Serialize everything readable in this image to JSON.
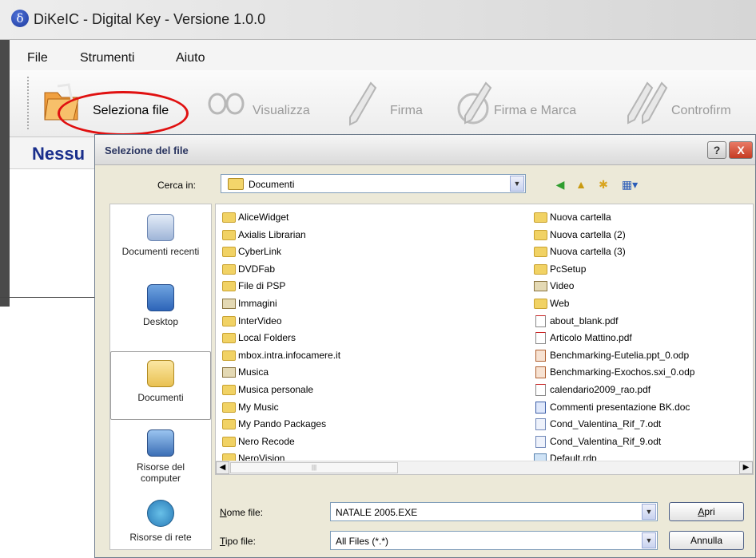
{
  "app": {
    "title": "DiKeIC - Digital Key - Versione 1.0.0",
    "icon_glyph": "δ",
    "menu": [
      "File",
      "Strumenti",
      "Aiuto"
    ],
    "toolbar": [
      {
        "label": "Seleziona file",
        "icon": "folder-icon",
        "enabled": true
      },
      {
        "label": "Visualizza",
        "icon": "glasses-icon",
        "enabled": false
      },
      {
        "label": "Firma",
        "icon": "pen-icon",
        "enabled": false
      },
      {
        "label": "Firma e Marca",
        "icon": "pen-stamp-icon",
        "enabled": false
      },
      {
        "label": "Controfirm",
        "icon": "double-pen-icon",
        "enabled": false
      }
    ],
    "status_text": "Nessu"
  },
  "dialog": {
    "title": "Selezione del file",
    "help_label": "?",
    "close_label": "X",
    "lookin_label": "Cerca in:",
    "lookin_value": "Documenti",
    "places": [
      {
        "label": "Documenti recenti",
        "icon": "recent-documents-icon"
      },
      {
        "label": "Desktop",
        "icon": "desktop-icon"
      },
      {
        "label": "Documenti",
        "icon": "documents-folder-icon",
        "selected": true
      },
      {
        "label": "Risorse del computer",
        "icon": "computer-icon"
      },
      {
        "label": "Risorse di rete",
        "icon": "network-icon"
      }
    ],
    "files_col1": [
      {
        "name": "AliceWidget",
        "type": "folder"
      },
      {
        "name": "Axialis Librarian",
        "type": "folder"
      },
      {
        "name": "CyberLink",
        "type": "folder"
      },
      {
        "name": "DVDFab",
        "type": "folder"
      },
      {
        "name": "File di PSP",
        "type": "folder"
      },
      {
        "name": "Immagini",
        "type": "special"
      },
      {
        "name": "InterVideo",
        "type": "folder"
      },
      {
        "name": "Local Folders",
        "type": "folder"
      },
      {
        "name": "mbox.intra.infocamere.it",
        "type": "folder"
      },
      {
        "name": "Musica",
        "type": "special"
      },
      {
        "name": "Musica personale",
        "type": "folder"
      },
      {
        "name": "My Music",
        "type": "folder"
      },
      {
        "name": "My Pando Packages",
        "type": "folder"
      },
      {
        "name": "Nero Recode",
        "type": "folder"
      },
      {
        "name": "NeroVision",
        "type": "folder"
      }
    ],
    "files_col2": [
      {
        "name": "Nuova cartella",
        "type": "folder"
      },
      {
        "name": "Nuova cartella (2)",
        "type": "folder"
      },
      {
        "name": "Nuova cartella (3)",
        "type": "folder"
      },
      {
        "name": "PcSetup",
        "type": "folder"
      },
      {
        "name": "Video",
        "type": "special"
      },
      {
        "name": "Web",
        "type": "folder"
      },
      {
        "name": "about_blank.pdf",
        "type": "pdf"
      },
      {
        "name": "Articolo Mattino.pdf",
        "type": "pdf"
      },
      {
        "name": "Benchmarking-Eutelia.ppt_0.odp",
        "type": "odp"
      },
      {
        "name": "Benchmarking-Exochos.sxi_0.odp",
        "type": "odp"
      },
      {
        "name": "calendario2009_rao.pdf",
        "type": "pdf"
      },
      {
        "name": "Commenti presentazione BK.doc",
        "type": "doc"
      },
      {
        "name": "Cond_Valentina_Rif_7.odt",
        "type": "odt"
      },
      {
        "name": "Cond_Valentina_Rif_9.odt",
        "type": "odt"
      },
      {
        "name": "Default.rdp",
        "type": "rdp"
      }
    ],
    "filename_label": "Nome file:",
    "filename_value": "NATALE 2005.EXE",
    "filetype_label": "Tipo file:",
    "filetype_value": "All Files (*.*)",
    "open_label": "Apri",
    "cancel_label": "Annulla"
  },
  "colors": {
    "status_text": "#1a2f8c",
    "highlight_ring": "#e01010",
    "close_button": "#c53b22"
  }
}
